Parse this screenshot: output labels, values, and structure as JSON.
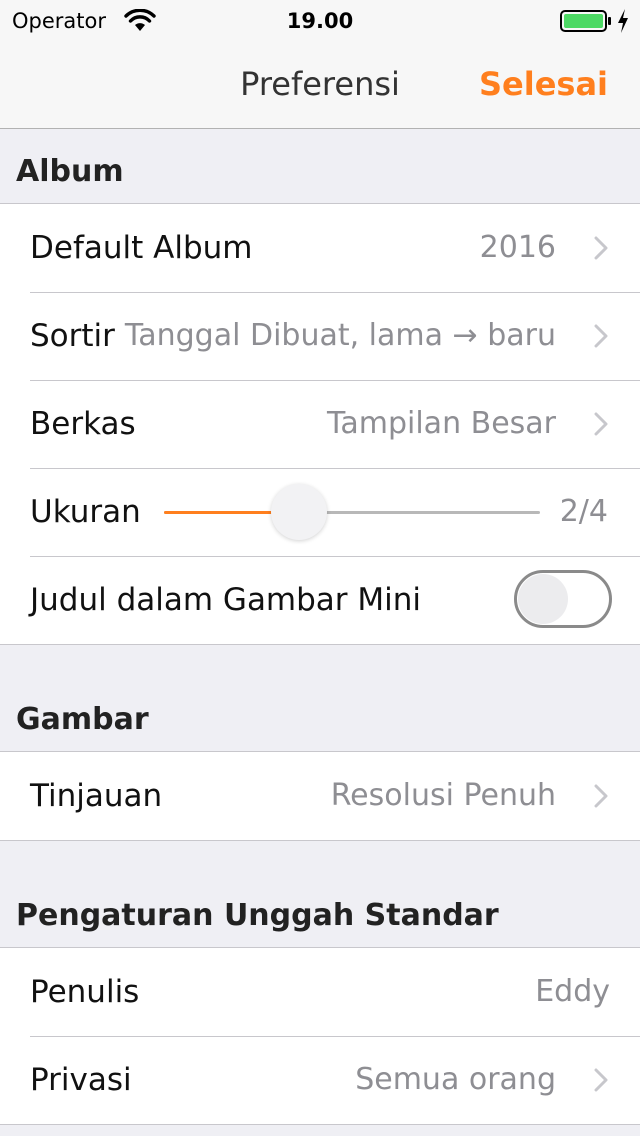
{
  "status_bar": {
    "carrier": "Operator",
    "time": "19.00",
    "battery_level": 1.0
  },
  "nav": {
    "title": "Preferensi",
    "done_label": "Selesai"
  },
  "colors": {
    "accent": "#ff7f1e"
  },
  "sections": {
    "album": {
      "header": "Album",
      "default_album": {
        "label": "Default Album",
        "value": "2016"
      },
      "sort": {
        "label": "Sortir",
        "value": "Tanggal Dibuat, lama → baru"
      },
      "files": {
        "label": "Berkas",
        "value": "Tampilan Besar"
      },
      "size": {
        "label": "Ukuran",
        "value": "2/4",
        "slider_fraction": 0.36
      },
      "thumbnail_titles": {
        "label": "Judul dalam Gambar Mini",
        "on": false
      }
    },
    "image": {
      "header": "Gambar",
      "preview": {
        "label": "Tinjauan",
        "value": "Resolusi Penuh"
      }
    },
    "upload": {
      "header": "Pengaturan Unggah Standar",
      "author": {
        "label": "Penulis",
        "value": "Eddy"
      },
      "privacy": {
        "label": "Privasi",
        "value": "Semua orang"
      }
    }
  }
}
